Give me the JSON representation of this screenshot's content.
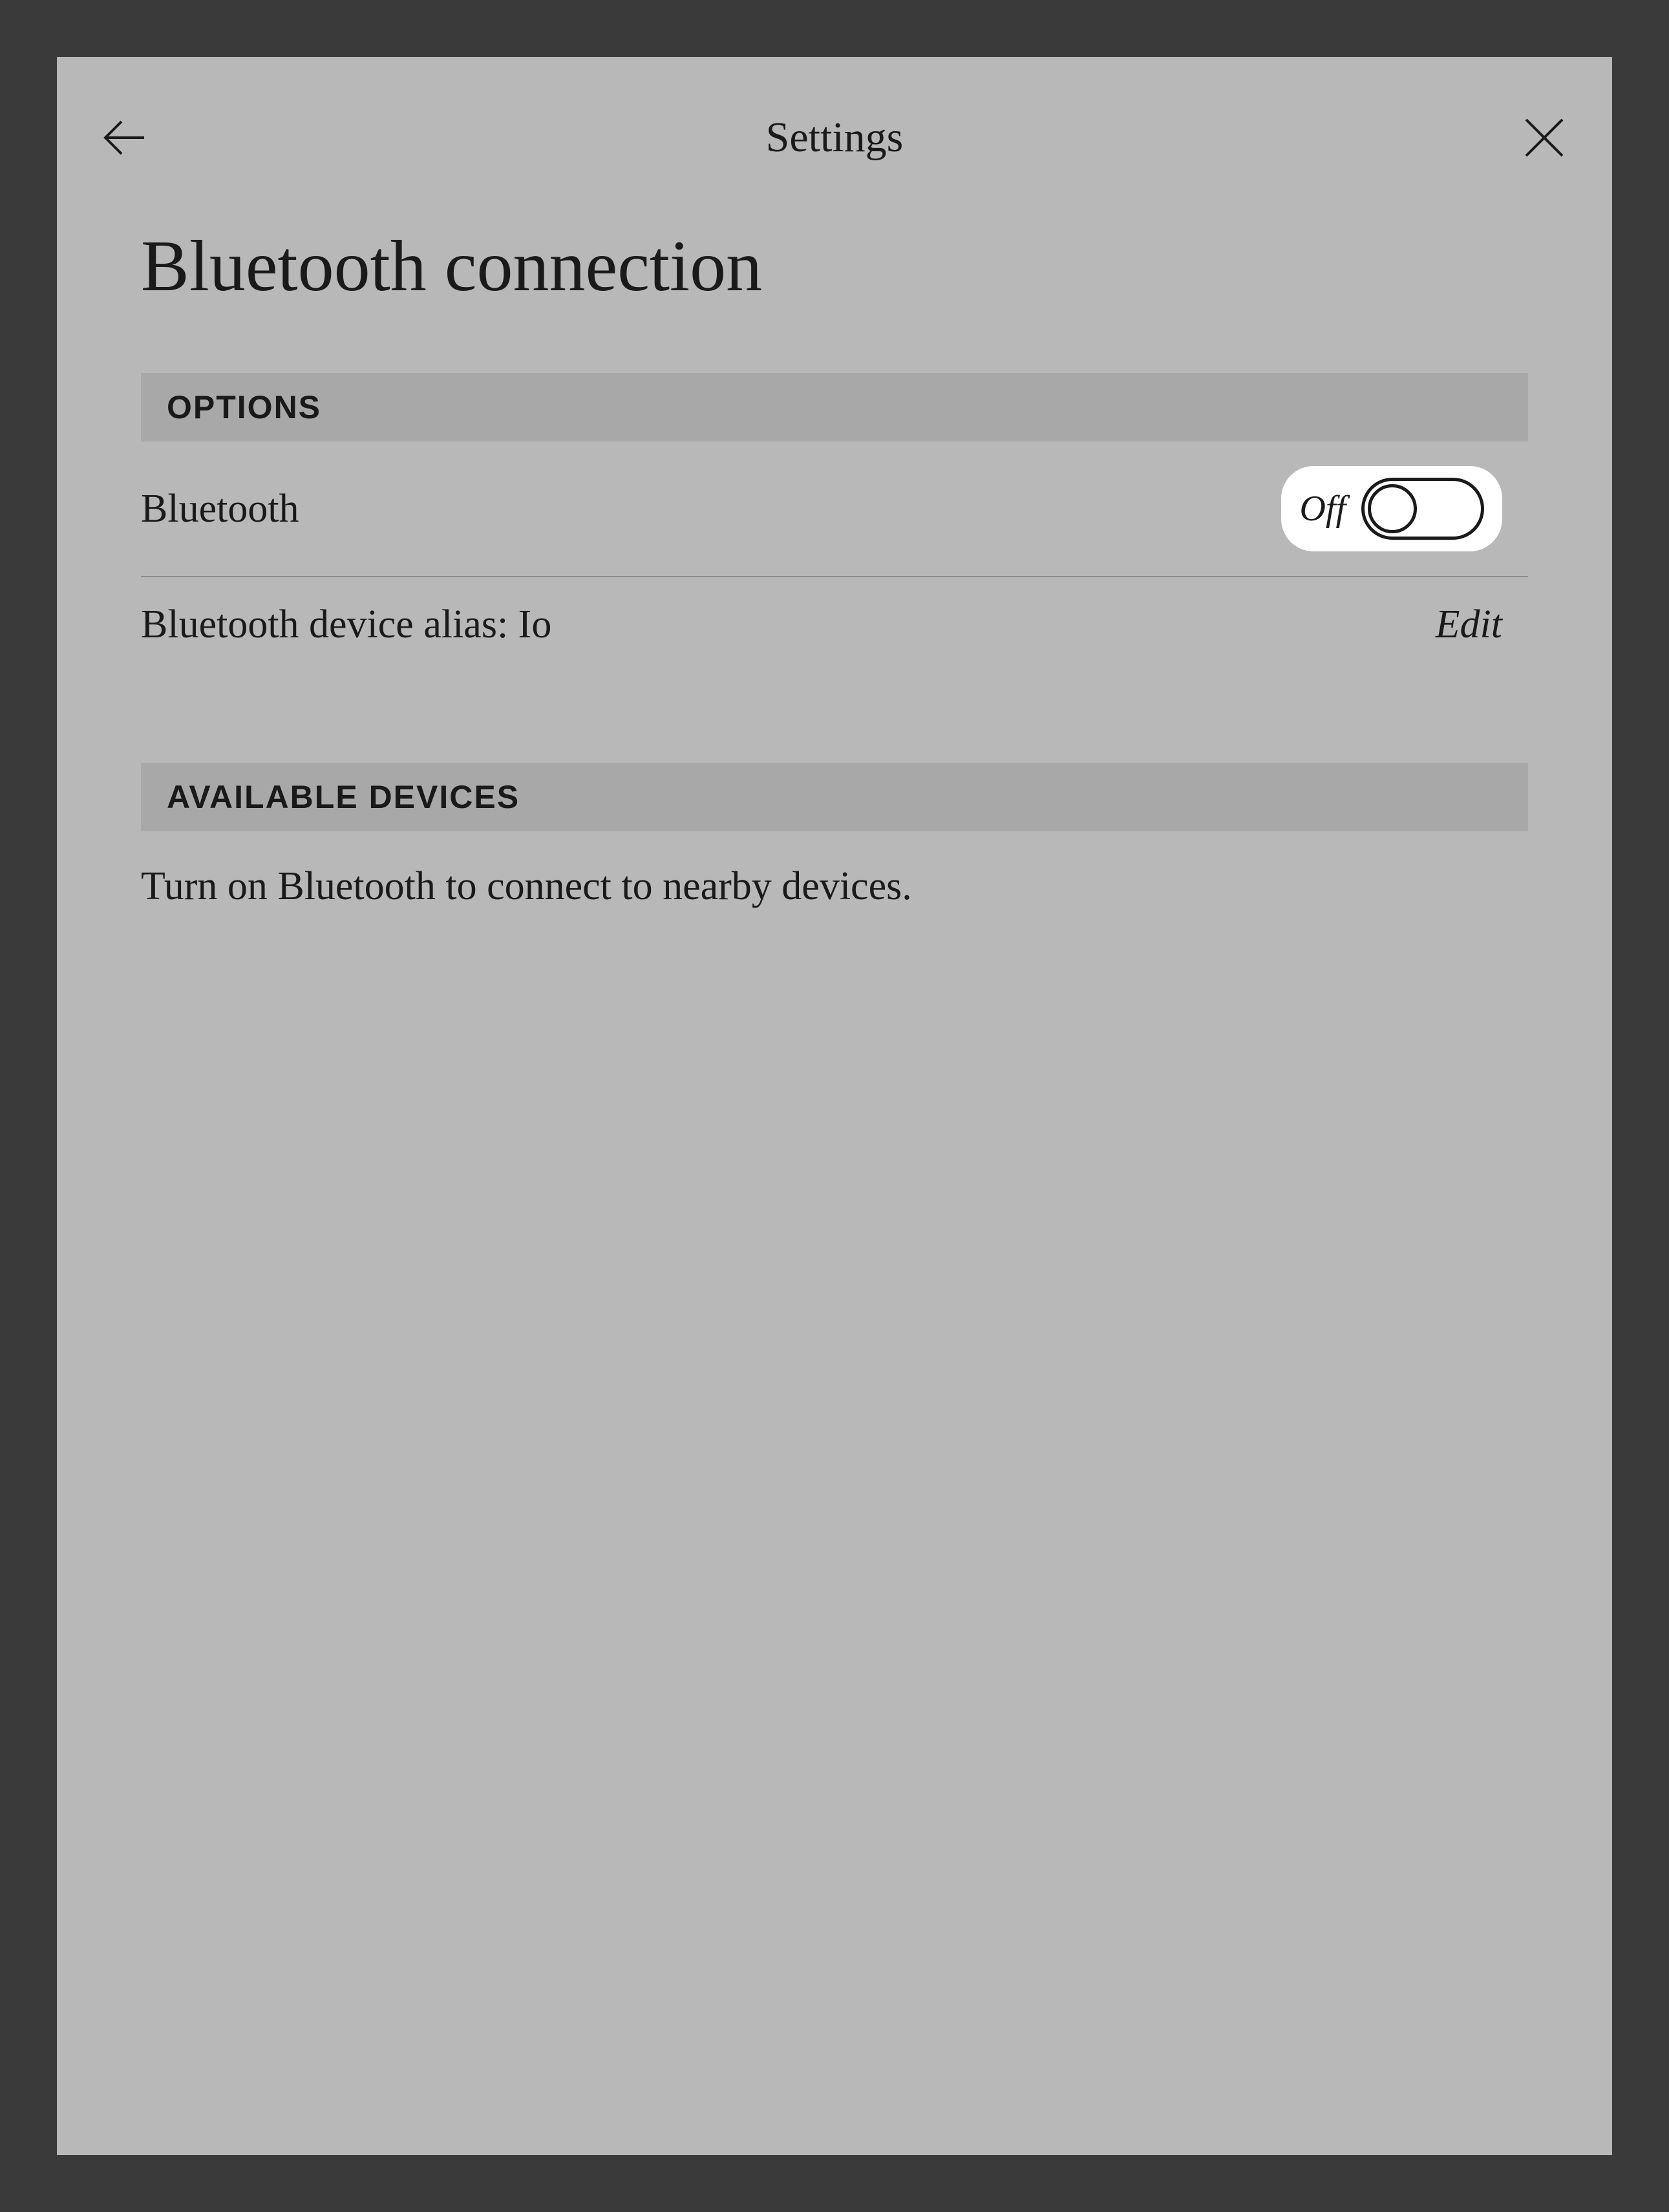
{
  "header": {
    "title": "Settings"
  },
  "page": {
    "title": "Bluetooth connection"
  },
  "sections": {
    "options": {
      "header": "OPTIONS",
      "bluetooth": {
        "label": "Bluetooth",
        "toggle_state": "Off"
      },
      "alias": {
        "label": "Bluetooth device alias: Io",
        "action": "Edit"
      }
    },
    "available": {
      "header": "AVAILABLE DEVICES",
      "message": "Turn on Bluetooth to connect to nearby devices."
    }
  }
}
